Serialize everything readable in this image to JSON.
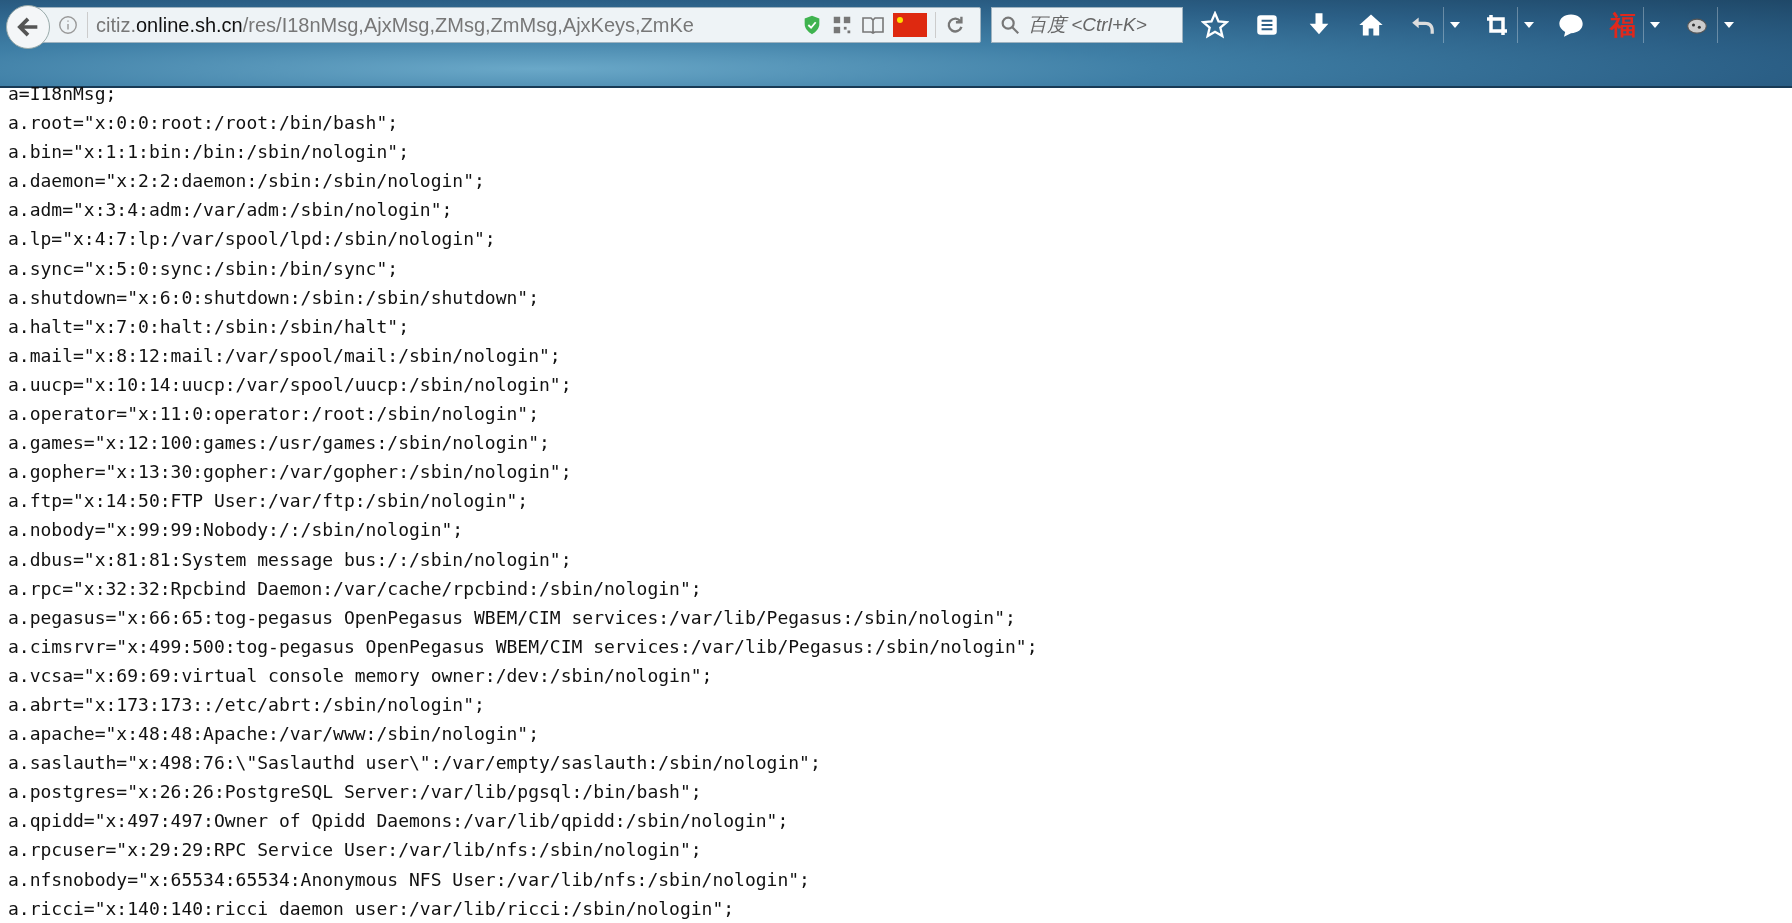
{
  "toolbar": {
    "url": {
      "prefix": "citiz.",
      "domain": "online.sh.cn",
      "path": "/res/I18nMsg,AjxMsg,ZMsg,ZmMsg,AjxKeys,ZmKe"
    },
    "search": {
      "placeholder": "百度 <Ctrl+K>"
    },
    "extension_label": "福"
  },
  "lines": [
    "a=I18nMsg;",
    "a.root=\"x:0:0:root:/root:/bin/bash\";",
    "a.bin=\"x:1:1:bin:/bin:/sbin/nologin\";",
    "a.daemon=\"x:2:2:daemon:/sbin:/sbin/nologin\";",
    "a.adm=\"x:3:4:adm:/var/adm:/sbin/nologin\";",
    "a.lp=\"x:4:7:lp:/var/spool/lpd:/sbin/nologin\";",
    "a.sync=\"x:5:0:sync:/sbin:/bin/sync\";",
    "a.shutdown=\"x:6:0:shutdown:/sbin:/sbin/shutdown\";",
    "a.halt=\"x:7:0:halt:/sbin:/sbin/halt\";",
    "a.mail=\"x:8:12:mail:/var/spool/mail:/sbin/nologin\";",
    "a.uucp=\"x:10:14:uucp:/var/spool/uucp:/sbin/nologin\";",
    "a.operator=\"x:11:0:operator:/root:/sbin/nologin\";",
    "a.games=\"x:12:100:games:/usr/games:/sbin/nologin\";",
    "a.gopher=\"x:13:30:gopher:/var/gopher:/sbin/nologin\";",
    "a.ftp=\"x:14:50:FTP User:/var/ftp:/sbin/nologin\";",
    "a.nobody=\"x:99:99:Nobody:/:/sbin/nologin\";",
    "a.dbus=\"x:81:81:System message bus:/:/sbin/nologin\";",
    "a.rpc=\"x:32:32:Rpcbind Daemon:/var/cache/rpcbind:/sbin/nologin\";",
    "a.pegasus=\"x:66:65:tog-pegasus OpenPegasus WBEM/CIM services:/var/lib/Pegasus:/sbin/nologin\";",
    "a.cimsrvr=\"x:499:500:tog-pegasus OpenPegasus WBEM/CIM services:/var/lib/Pegasus:/sbin/nologin\";",
    "a.vcsa=\"x:69:69:virtual console memory owner:/dev:/sbin/nologin\";",
    "a.abrt=\"x:173:173::/etc/abrt:/sbin/nologin\";",
    "a.apache=\"x:48:48:Apache:/var/www:/sbin/nologin\";",
    "a.saslauth=\"x:498:76:\\\"Saslauthd user\\\":/var/empty/saslauth:/sbin/nologin\";",
    "a.postgres=\"x:26:26:PostgreSQL Server:/var/lib/pgsql:/bin/bash\";",
    "a.qpidd=\"x:497:497:Owner of Qpidd Daemons:/var/lib/qpidd:/sbin/nologin\";",
    "a.rpcuser=\"x:29:29:RPC Service User:/var/lib/nfs:/sbin/nologin\";",
    "a.nfsnobody=\"x:65534:65534:Anonymous NFS User:/var/lib/nfs:/sbin/nologin\";",
    "a.ricci=\"x:140:140:ricci daemon user:/var/lib/ricci:/sbin/nologin\";"
  ]
}
